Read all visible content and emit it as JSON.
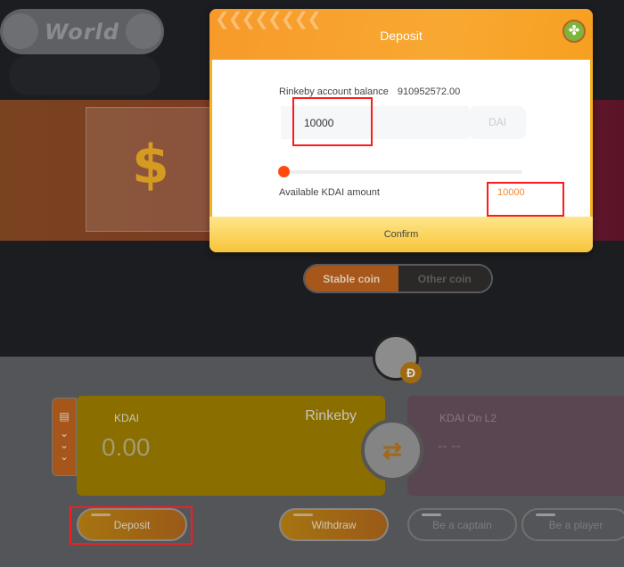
{
  "header": {
    "world_label": "World"
  },
  "tabs": {
    "stable": "Stable coin",
    "other": "Other coin"
  },
  "card": {
    "token": "KDAI",
    "balance": "0.00",
    "network": "Rinkeby"
  },
  "card_l2": {
    "token": "KDAI On L2",
    "balance": "-- --"
  },
  "buttons": {
    "deposit": "Deposit",
    "withdraw": "Withdraw",
    "captain": "Be a captain",
    "player": "Be a player"
  },
  "modal": {
    "title": "Deposit",
    "balance_label": "Rinkeby account balance",
    "balance_value": "910952572.00",
    "amount_value": "10000",
    "unit": "DAI",
    "slider_percent": 0,
    "available_label": "Available KDAI amount",
    "available_value": "10000",
    "confirm": "Confirm"
  },
  "colors": {
    "accent": "#f8a832",
    "slider": "#ff4a0c",
    "highlight": "#ff1a1a"
  }
}
